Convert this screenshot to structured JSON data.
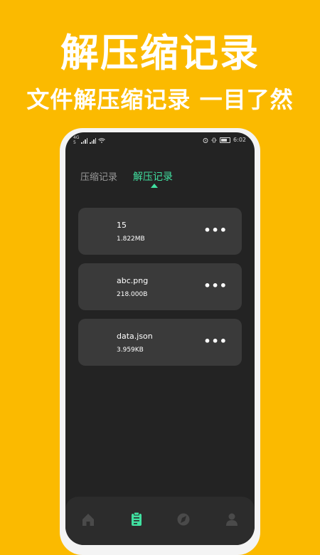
{
  "promo": {
    "headline": "解压缩记录",
    "subheadline": "文件解压缩记录 一目了然"
  },
  "status_bar": {
    "left_top": "4G",
    "left_bottom": "5",
    "time": "6:02"
  },
  "tabs": [
    {
      "label": "压缩记录",
      "active": false
    },
    {
      "label": "解压记录",
      "active": true
    }
  ],
  "records": [
    {
      "name": "15",
      "size": "1.822MB"
    },
    {
      "name": "abc.png",
      "size": "218.000B"
    },
    {
      "name": "data.json",
      "size": "3.959KB"
    }
  ],
  "bottom_nav": [
    {
      "icon": "home-icon",
      "active": false
    },
    {
      "icon": "clipboard-icon",
      "active": true
    },
    {
      "icon": "compass-icon",
      "active": false
    },
    {
      "icon": "user-icon",
      "active": false
    }
  ],
  "colors": {
    "background": "#FBBA00",
    "accent": "#40E0A0",
    "screen": "#232323",
    "card": "#3a3a3a"
  }
}
